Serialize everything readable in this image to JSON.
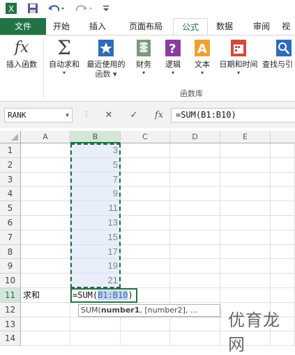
{
  "qat": {
    "save_icon": "save-icon",
    "undo_icon": "undo-icon",
    "redo_icon": "redo-icon",
    "customize_icon": "customize-icon"
  },
  "tabs": [
    "文件",
    "开始",
    "插入",
    "页面布局",
    "公式",
    "数据",
    "审阅",
    "视"
  ],
  "ribbon": {
    "buttons": [
      {
        "label": "插入函数",
        "sub": "",
        "icon": "fx-icon"
      },
      {
        "label": "自动求和",
        "sub": "▾",
        "icon": "sigma-icon"
      },
      {
        "label": "最近使用的",
        "sub": "函数 ▾",
        "icon": "star-icon"
      },
      {
        "label": "财务",
        "sub": "▾",
        "icon": "coins-icon"
      },
      {
        "label": "逻辑",
        "sub": "▾",
        "icon": "question-icon"
      },
      {
        "label": "文本",
        "sub": "▾",
        "icon": "text-a-icon"
      },
      {
        "label": "日期和时间",
        "sub": "▾",
        "icon": "calendar-icon"
      },
      {
        "label": "查找与引",
        "sub": "",
        "icon": "lookup-icon"
      }
    ],
    "group_label": "函数库"
  },
  "formula_bar": {
    "name_box": "RANK",
    "cancel": "✕",
    "enter": "✓",
    "fx": "fx",
    "formula": "=SUM(B1:B10)"
  },
  "grid": {
    "columns": [
      "A",
      "B",
      "C",
      "D",
      "E"
    ],
    "rows": [
      "1",
      "2",
      "3",
      "4",
      "5",
      "6",
      "7",
      "8",
      "9",
      "10",
      "11",
      "12",
      "13",
      "14"
    ],
    "b_values": [
      "3",
      "5",
      "7",
      "9",
      "11",
      "13",
      "15",
      "17",
      "19",
      "21"
    ],
    "a11": "求和",
    "b11_prefix": "=SUM(",
    "b11_ref": "B1:B10",
    "b11_suffix": ")",
    "tooltip_func": "SUM(",
    "tooltip_arg1": "number1",
    "tooltip_rest": ", [number2], ..."
  },
  "watermark": "优育龙网",
  "colors": {
    "accent": "#217346",
    "range_border": "#216b3d"
  }
}
